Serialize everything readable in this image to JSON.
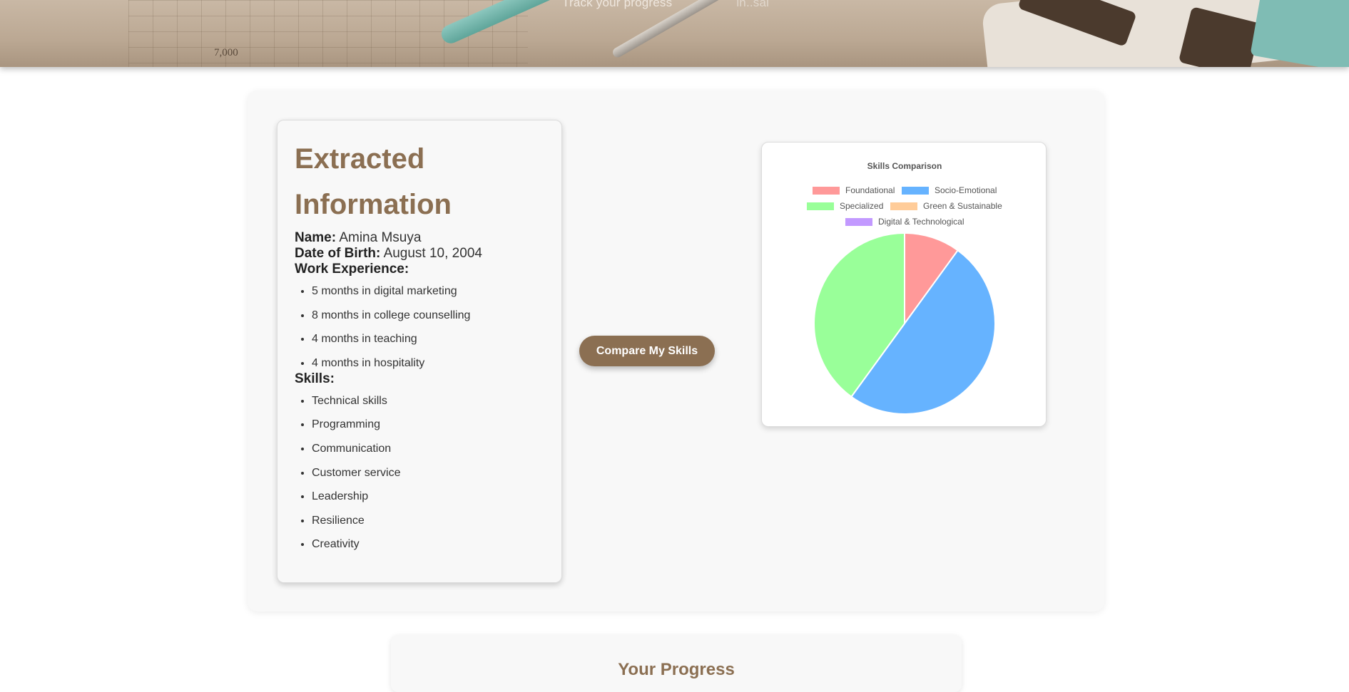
{
  "hero": {
    "tagline_start": "Track your progress",
    "tagline_end": "in..sai",
    "chart_number": "7,000"
  },
  "info": {
    "title": "Extracted Information",
    "name_label": "Name:",
    "name_value": "Amina Msuya",
    "dob_label": "Date of Birth:",
    "dob_value": "August 10, 2004",
    "work_label": "Work Experience:",
    "work_items": [
      "5 months in digital marketing",
      "8 months in college counselling",
      "4 months in teaching",
      "4 months in hospitality"
    ],
    "skills_label": "Skills:",
    "skill_items": [
      "Technical skills",
      "Programming",
      "Communication",
      "Customer service",
      "Leadership",
      "Resilience",
      "Creativity"
    ]
  },
  "actions": {
    "compare_label": "Compare My Skills"
  },
  "chart_data": {
    "type": "pie",
    "title": "Skills Comparison",
    "legend_position": "top",
    "labels": [
      "Foundational",
      "Socio-Emotional",
      "Specialized",
      "Green & Sustainable",
      "Digital & Technological"
    ],
    "values": [
      1,
      5,
      4,
      0,
      0
    ],
    "colors": [
      "#ff9999",
      "#66b3ff",
      "#99ff99",
      "#ffcc99",
      "#c299ff"
    ]
  },
  "progress": {
    "title": "Your Progress"
  }
}
